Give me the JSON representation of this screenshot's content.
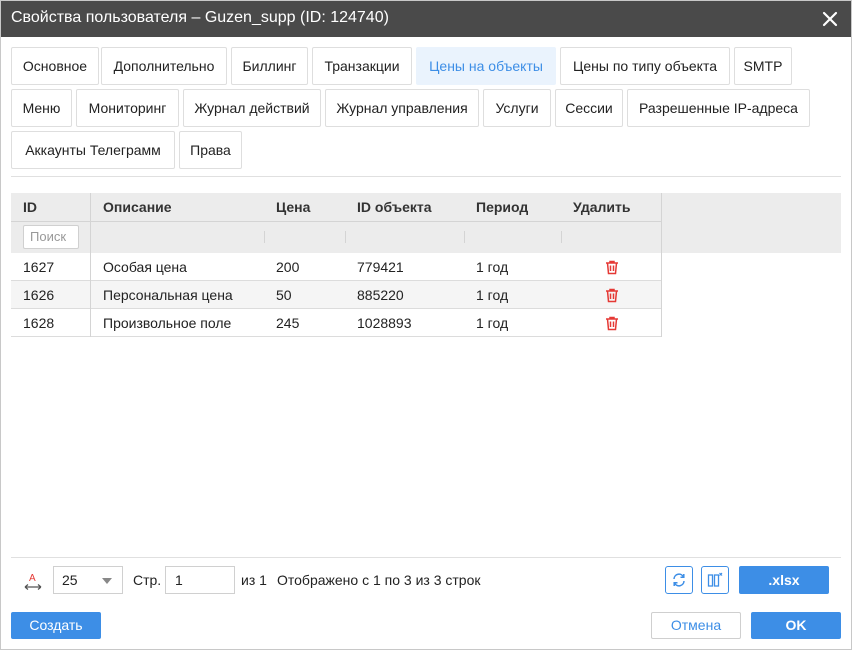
{
  "window": {
    "title": "Свойства пользователя – Guzen_supp (ID: 124740)"
  },
  "tabs": [
    {
      "label": "Основное"
    },
    {
      "label": "Дополнительно"
    },
    {
      "label": "Биллинг"
    },
    {
      "label": "Транзакции"
    },
    {
      "label": "Цены на объекты",
      "active": true
    },
    {
      "label": "Цены по типу объекта"
    },
    {
      "label": "SMTP"
    },
    {
      "label": "Меню"
    },
    {
      "label": "Мониторинг"
    },
    {
      "label": "Журнал действий"
    },
    {
      "label": "Журнал управления"
    },
    {
      "label": "Услуги"
    },
    {
      "label": "Сессии"
    },
    {
      "label": "Разрешенные IP-адреса"
    },
    {
      "label": "Аккаунты Телеграмм"
    },
    {
      "label": "Права"
    }
  ],
  "table": {
    "columns": [
      "ID",
      "Описание",
      "Цена",
      "ID объекта",
      "Период",
      "Удалить"
    ],
    "search_placeholder": "Поиск",
    "rows": [
      {
        "id": "1627",
        "description": "Особая цена",
        "price": "200",
        "object_id": "779421",
        "period": "1 год"
      },
      {
        "id": "1626",
        "description": "Персональная цена",
        "price": "50",
        "object_id": "885220",
        "period": "1 год"
      },
      {
        "id": "1628",
        "description": "Произвольное поле",
        "price": "245",
        "object_id": "1028893",
        "period": "1 год"
      }
    ]
  },
  "pager": {
    "page_size": "25",
    "page_label": "Стр.",
    "page_value": "1",
    "of_label": "из 1",
    "summary": "Отображено с 1 по 3 из 3 строк",
    "export_label": ".xlsx"
  },
  "buttons": {
    "create": "Создать",
    "cancel": "Отмена",
    "ok": "OK"
  },
  "colors": {
    "accent": "#3d8ee6",
    "titlebar": "#4a4a4a",
    "delete": "#e53935",
    "active_tab_bg": "#eaf3fd"
  },
  "icons": {
    "close": "close-icon",
    "delete": "trash-icon",
    "font_size": "font-size-icon",
    "refresh": "refresh-icon",
    "columns": "columns-settings-icon"
  }
}
